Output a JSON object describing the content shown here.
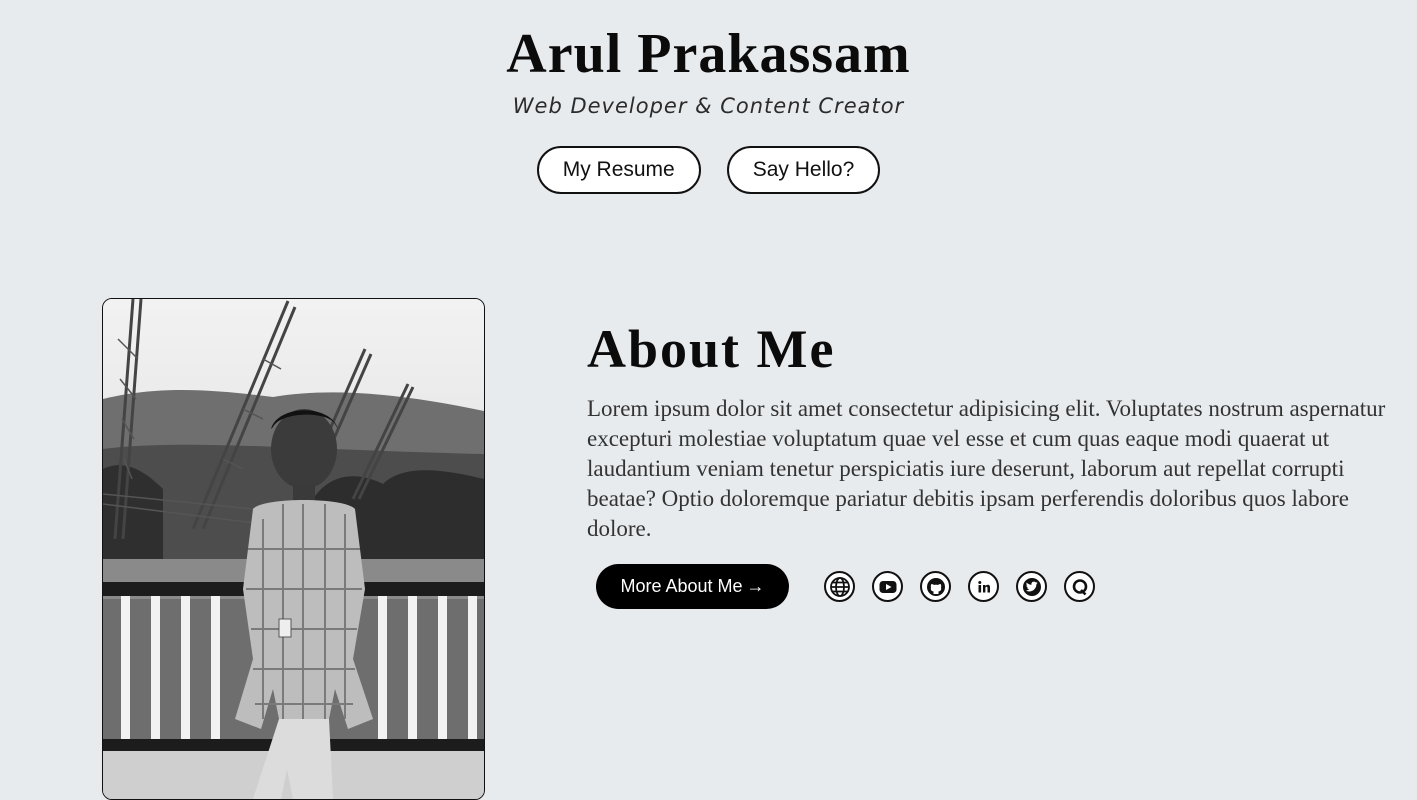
{
  "header": {
    "name": "Arul Prakassam",
    "subtitle": "Web Developer & Content Creator",
    "resume_button": "My Resume",
    "hello_button": "Say Hello?"
  },
  "about": {
    "heading": "About Me",
    "body": "Lorem ipsum dolor sit amet consectetur adipisicing elit. Voluptates nostrum aspernatur excepturi molestiae voluptatum quae vel esse et cum quas eaque modi quaerat ut laudantium veniam tenetur perspiciatis iure deserunt, laborum aut repellat corrupti beatae? Optio doloremque pariatur debitis ipsam perferendis doloribus quos labore dolore.",
    "more_button": "More About Me",
    "more_arrow": "→"
  },
  "social_icons": [
    "globe-icon",
    "youtube-icon",
    "github-icon",
    "linkedin-icon",
    "twitter-icon",
    "quora-icon"
  ],
  "colors": {
    "background": "#e8ebee",
    "primary_text": "#0b0b0b",
    "button_dark": "#000000",
    "button_light": "#ffffff"
  }
}
